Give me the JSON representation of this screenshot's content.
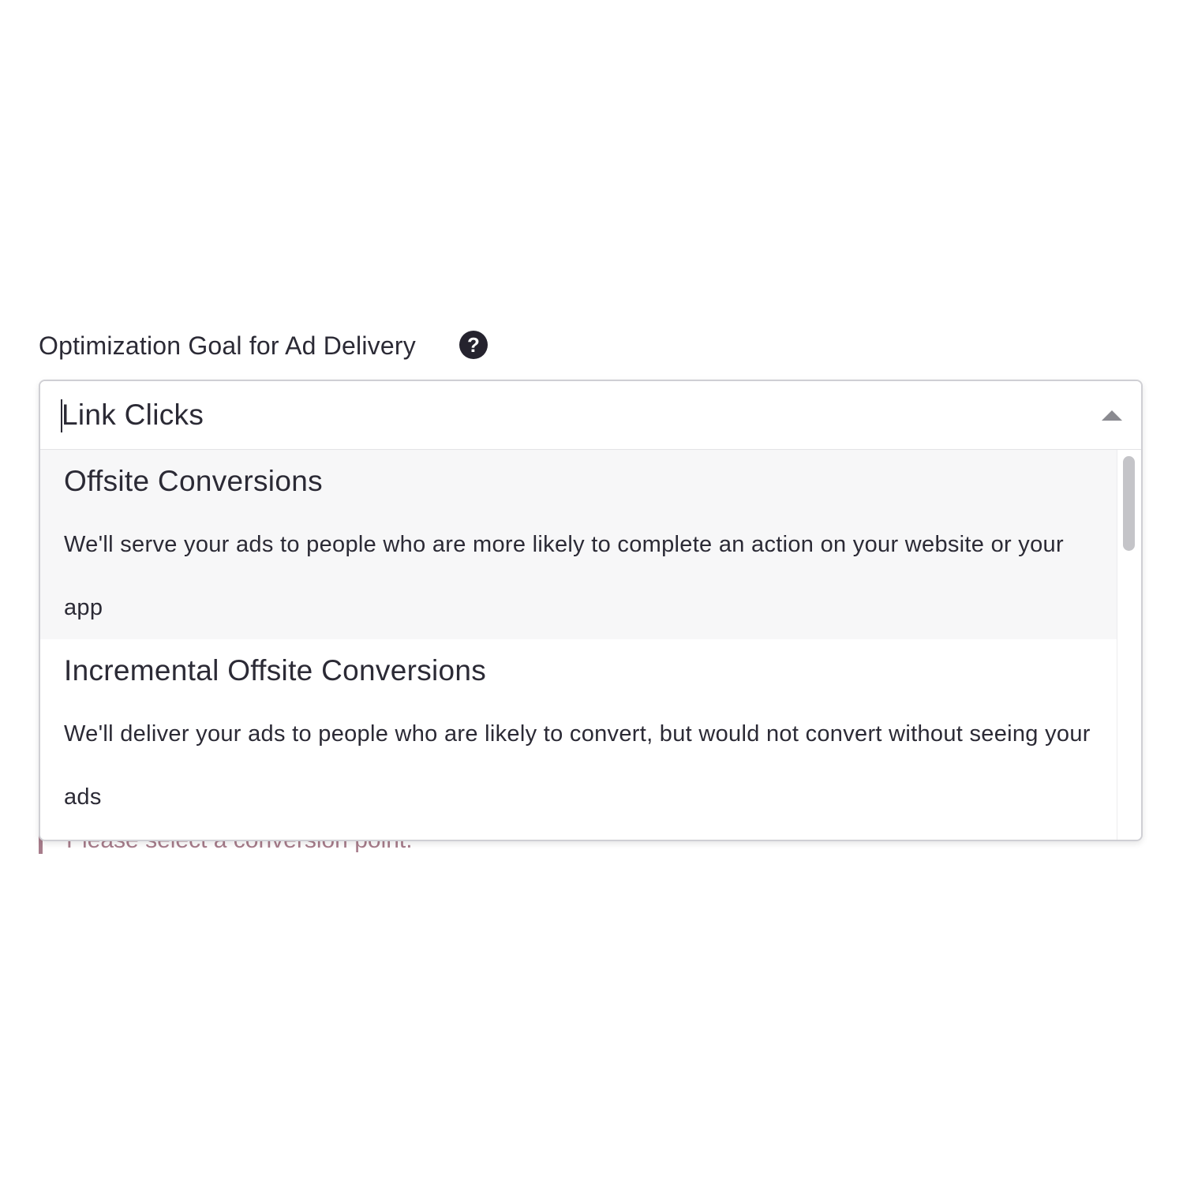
{
  "field": {
    "label": "Optimization Goal for Ad Delivery",
    "help_icon": "question-circle-icon",
    "selected_value": "Link Clicks",
    "hidden_error": "Please select a conversion point."
  },
  "dropdown": {
    "expanded": true,
    "toggle_icon": "chevron-up-icon",
    "options": [
      {
        "title": "Offsite Conversions",
        "description": "We'll serve your ads to people who are more likely to complete an action on your website or your app",
        "highlighted": true
      },
      {
        "title": "Incremental Offsite Conversions",
        "description": "We'll deliver your ads to people who are likely to convert, but would not convert without seeing your ads",
        "highlighted": false
      }
    ]
  },
  "colors": {
    "text": "#2b2a35",
    "highlight_bg": "#f7f7f8",
    "border": "#cfcfd4",
    "error": "#a77c8b"
  }
}
